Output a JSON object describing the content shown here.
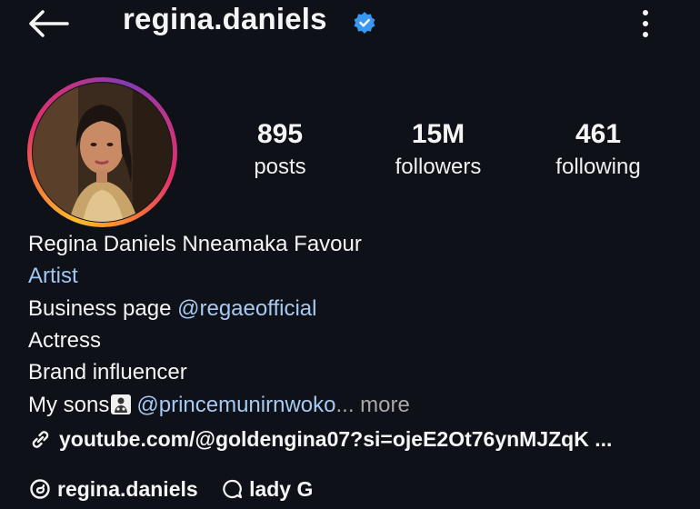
{
  "header": {
    "username": "regina.daniels",
    "back_icon": "arrow-left-icon",
    "verified_icon": "verified-badge-icon",
    "more_icon": "more-vertical-icon"
  },
  "stats": {
    "posts": {
      "value": "895",
      "label": "posts"
    },
    "followers": {
      "value": "15M",
      "label": "followers"
    },
    "following": {
      "value": "461",
      "label": "following"
    }
  },
  "bio": {
    "name": "Regina Daniels Nneamaka Favour",
    "category": "Artist",
    "line3_prefix": "Business page ",
    "line3_mention": "@regaeofficial",
    "line4": "Actress",
    "line5": "Brand influencer",
    "line6_prefix": "My sons",
    "line6_mention": "@princemunirnwoko",
    "line6_more": "... more",
    "link": "youtube.com/@goldengina07?si=ojeE2Ot76ynMJZqK ..."
  },
  "bottom": {
    "threads_handle": "regina.daniels",
    "nickname": "lady G"
  },
  "colors": {
    "background": "#0e1117",
    "link_blue": "#a7c9f2",
    "verified_blue": "#3897f0"
  }
}
